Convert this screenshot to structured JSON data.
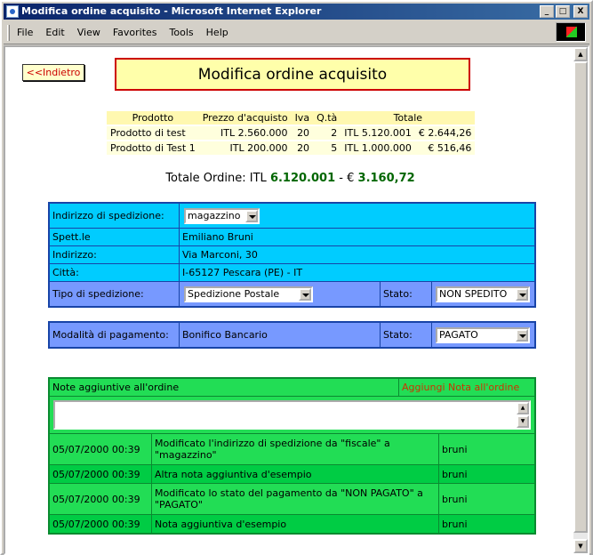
{
  "window": {
    "title": "Modifica ordine acquisito - Microsoft Internet Explorer",
    "controls": {
      "minimize": "_",
      "maximize": "□",
      "close": "X"
    }
  },
  "menu": [
    "File",
    "Edit",
    "View",
    "Favorites",
    "Tools",
    "Help"
  ],
  "page": {
    "back_label": "<<Indietro",
    "title": "Modifica ordine acquisito",
    "products": {
      "headers": [
        "Prodotto",
        "Prezzo d'acquisto",
        "Iva",
        "Q.tà",
        "Totale"
      ],
      "rows": [
        {
          "name": "Prodotto di test",
          "price": "ITL 2.560.000",
          "iva": "20",
          "qty": "2",
          "total_itl": "ITL 5.120.001",
          "total_eur": "€ 2.644,26"
        },
        {
          "name": "Prodotto di Test 1",
          "price": "ITL 200.000",
          "iva": "20",
          "qty": "5",
          "total_itl": "ITL 1.000.000",
          "total_eur": "€ 516,46"
        }
      ]
    },
    "order_total": {
      "label": "Totale Ordine: ITL",
      "itl": "6.120.001",
      "sep": "- €",
      "eur": "3.160,72"
    },
    "shipping": {
      "address_label": "Indirizzo di spedizione:",
      "address_select": "magazzino",
      "spettle_label": "Spett.le",
      "spettle_value": "Emiliano Bruni",
      "indirizzo_label": "Indirizzo:",
      "indirizzo_value": "Via Marconi, 30",
      "citta_label": "Città:",
      "citta_value": "I-65127 Pescara (PE) - IT",
      "tipo_label": "Tipo di spedizione:",
      "tipo_select": "Spedizione Postale",
      "stato_label": "Stato:",
      "stato_select": "NON SPEDITO"
    },
    "payment": {
      "label": "Modalità di pagamento:",
      "value": "Bonifico Bancario",
      "stato_label": "Stato:",
      "stato_select": "PAGATO"
    },
    "notes": {
      "header": "Note aggiuntive all'ordine",
      "add_label": "Aggiungi Nota all'ordine",
      "input_value": "",
      "items": [
        {
          "date": "05/07/2000 00:39",
          "text": "Modificato l'indirizzo di spedizione da \"fiscale\" a \"magazzino\"",
          "user": "bruni"
        },
        {
          "date": "05/07/2000 00:39",
          "text": "Altra nota aggiuntiva d'esempio",
          "user": "bruni"
        },
        {
          "date": "05/07/2000 00:39",
          "text": "Modificato lo stato del pagamento da \"NON PAGATO\" a \"PAGATO\"",
          "user": "bruni"
        },
        {
          "date": "05/07/2000 00:39",
          "text": "Nota aggiuntiva d'esempio",
          "user": "bruni"
        }
      ]
    }
  },
  "colors": {
    "titlebar": "#0a246a",
    "shipping_bg": "#00ccff",
    "shipping_border": "#1844a8",
    "notes_bg": "#22dd55",
    "total_green": "#006600",
    "back_text": "#cc0000"
  }
}
